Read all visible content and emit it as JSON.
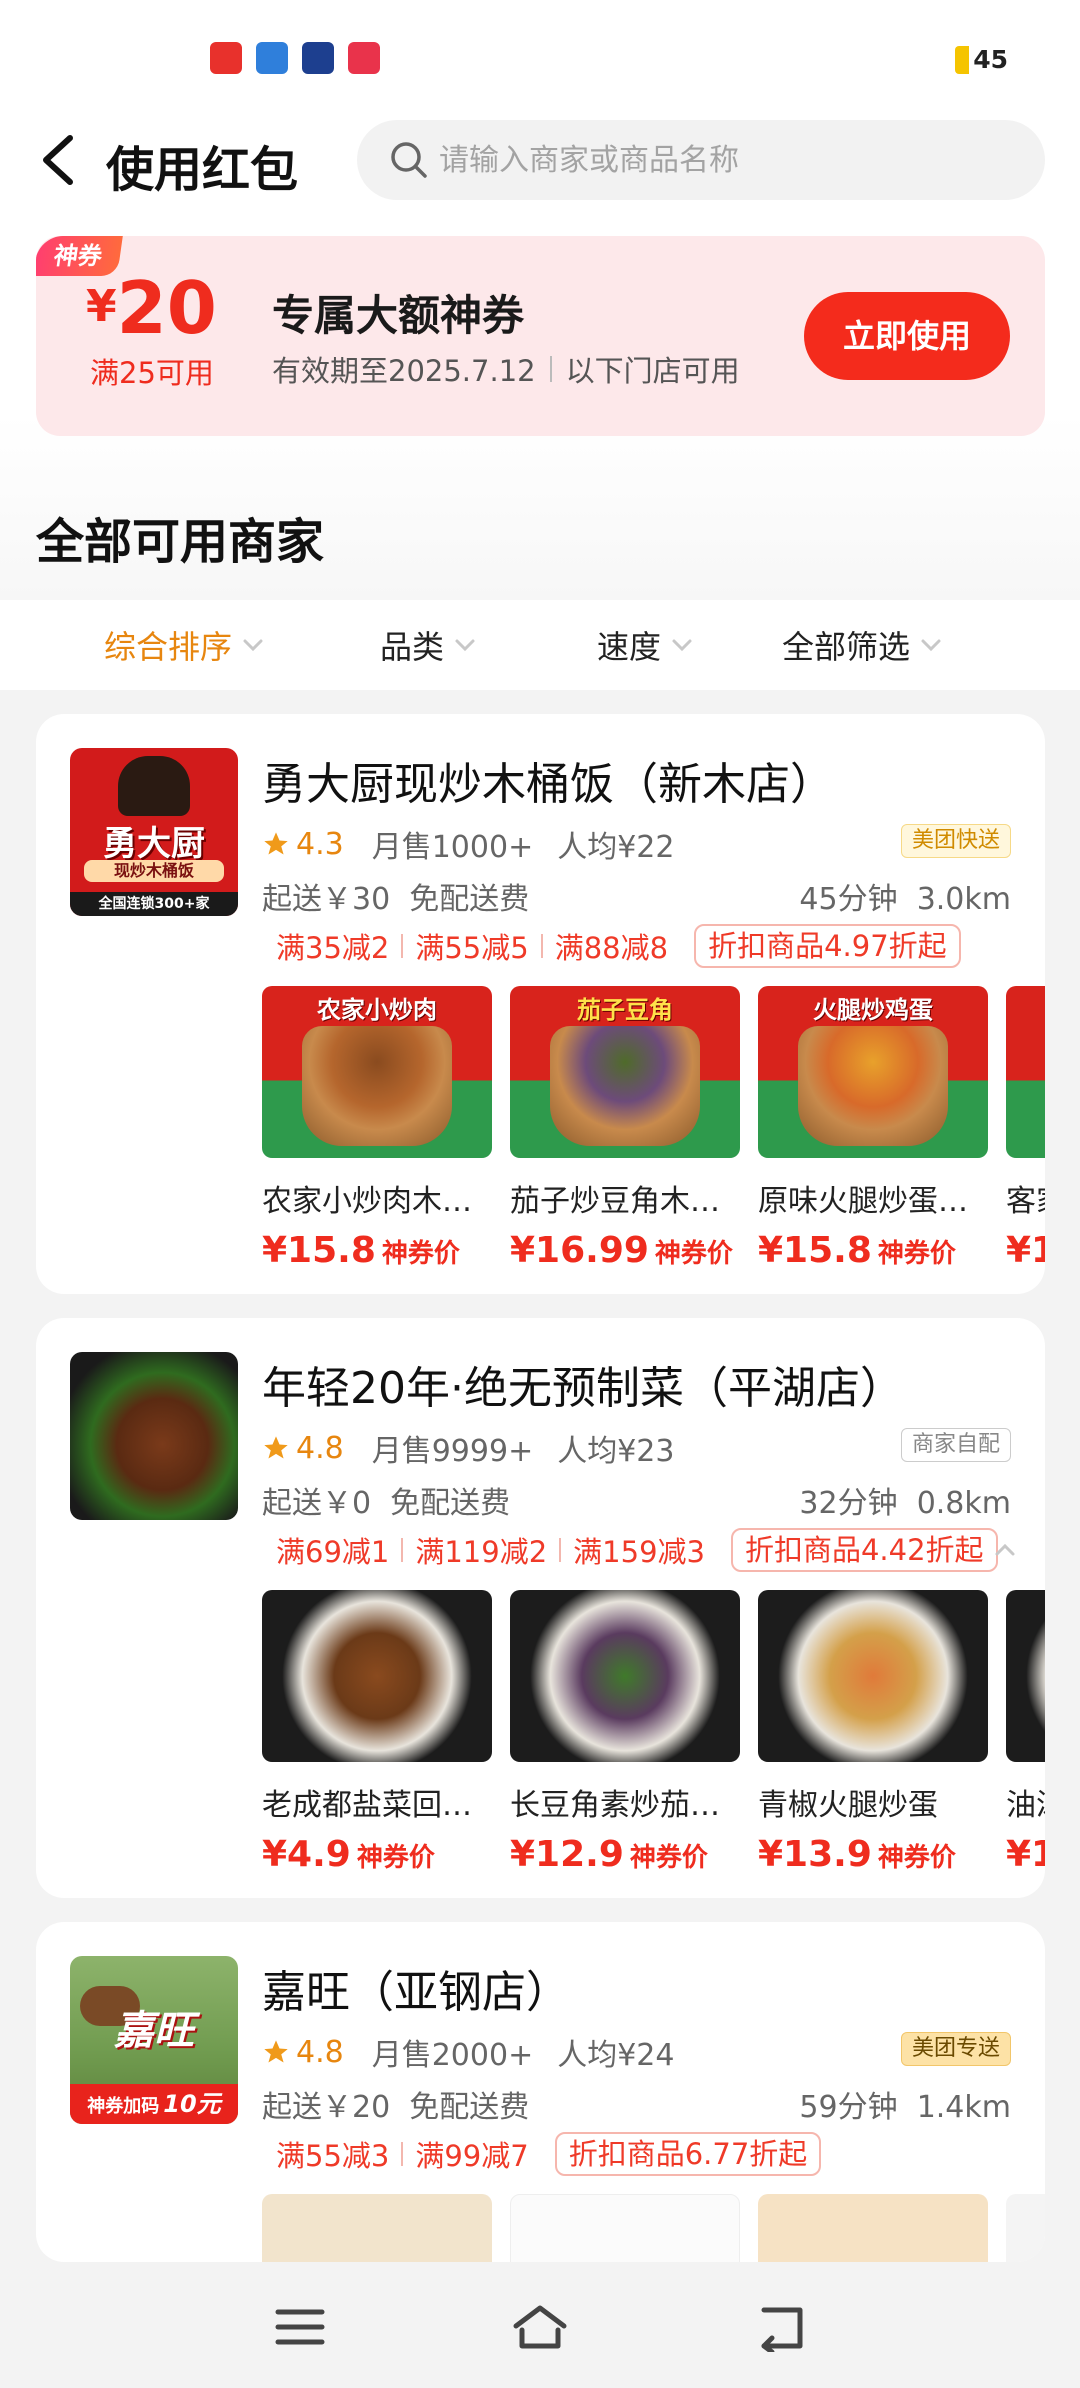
{
  "status_bar": {
    "battery": "45",
    "notification_icons": [
      "app-icon-red",
      "app-icon-blue",
      "app-icon-navy",
      "app-icon-pink"
    ]
  },
  "header": {
    "title": "使用红包",
    "search_placeholder": "请输入商家或商品名称"
  },
  "coupon": {
    "tag": "神券",
    "currency": "¥",
    "amount": "20",
    "condition": "满25可用",
    "title": "专属大额神券",
    "validity": "有效期至2025.7.12",
    "scope": "以下门店可用",
    "button": "立即使用"
  },
  "section_title": "全部可用商家",
  "filters": [
    {
      "label": "综合排序",
      "active": true
    },
    {
      "label": "品类",
      "active": false
    },
    {
      "label": "速度",
      "active": false
    },
    {
      "label": "全部筛选",
      "active": false
    }
  ],
  "shops": [
    {
      "name": "勇大厨现炒木桶饭（新木店）",
      "logo_texts": [
        "勇大厨",
        "现炒木桶饭",
        "全国连锁300+家"
      ],
      "rating": "4.3",
      "monthly_sales": "月售1000+",
      "avg_price": "人均¥22",
      "delivery_type": "美团快送",
      "min_order": "起送￥30",
      "delivery_fee": "免配送费",
      "time": "45分钟",
      "distance": "3.0km",
      "promos": [
        "满35减2",
        "满55减5",
        "满88减8"
      ],
      "discount": "折扣商品4.97折起",
      "dishes": [
        {
          "name": "农家小炒肉木…",
          "price": "¥15.8",
          "price_tag": "神券价",
          "banner": "农家小炒肉"
        },
        {
          "name": "茄子炒豆角木…",
          "price": "¥16.99",
          "price_tag": "神券价",
          "banner": "茄子豆角"
        },
        {
          "name": "原味火腿炒蛋…",
          "price": "¥15.8",
          "price_tag": "神券价",
          "banner": "火腿炒鸡蛋"
        },
        {
          "name": "客家",
          "price": "¥1",
          "price_tag": "",
          "banner": ""
        }
      ]
    },
    {
      "name": "年轻20年·绝无预制菜（平湖店）",
      "logo_texts": [],
      "rating": "4.8",
      "monthly_sales": "月售9999+",
      "avg_price": "人均¥23",
      "delivery_type": "商家自配",
      "min_order": "起送￥0",
      "delivery_fee": "免配送费",
      "time": "32分钟",
      "distance": "0.8km",
      "promos": [
        "满69减1",
        "满119减2",
        "满159减3"
      ],
      "discount": "折扣商品4.42折起",
      "dishes": [
        {
          "name": "老成都盐菜回…",
          "price": "¥4.9",
          "price_tag": "神券价",
          "banner": ""
        },
        {
          "name": "长豆角素炒茄…",
          "price": "¥12.9",
          "price_tag": "神券价",
          "banner": ""
        },
        {
          "name": "青椒火腿炒蛋",
          "price": "¥13.9",
          "price_tag": "神券价",
          "banner": ""
        },
        {
          "name": "油泼",
          "price": "¥1",
          "price_tag": "",
          "banner": ""
        }
      ]
    },
    {
      "name": "嘉旺（亚钢店）",
      "logo_texts": [
        "嘉旺",
        "神券加码",
        "10元"
      ],
      "rating": "4.8",
      "monthly_sales": "月售2000+",
      "avg_price": "人均¥24",
      "delivery_type": "美团专送",
      "min_order": "起送￥20",
      "delivery_fee": "免配送费",
      "time": "59分钟",
      "distance": "1.4km",
      "promos": [
        "满55减3",
        "满99减7"
      ],
      "discount": "折扣商品6.77折起",
      "dishes": []
    }
  ],
  "nav": {
    "buttons": [
      "menu-icon",
      "home-icon",
      "back-icon"
    ]
  },
  "colors": {
    "accent_orange": "#e7860f",
    "red": "#ef2c1e",
    "coupon_bg": "#fde8ea"
  }
}
